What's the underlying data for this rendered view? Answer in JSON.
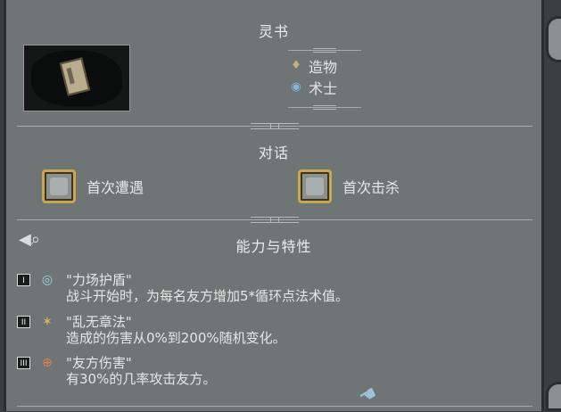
{
  "unit": {
    "name": "灵书",
    "types": [
      {
        "icon": "potion-icon",
        "label": "造物",
        "color": "#c8b27a"
      },
      {
        "icon": "eye-icon",
        "label": "术士",
        "color": "#7fb7e0"
      }
    ]
  },
  "dialogue": {
    "title": "对话",
    "items": [
      {
        "label": "首次遭遇"
      },
      {
        "label": "首次击杀"
      }
    ]
  },
  "abilities": {
    "title": "能力与特性",
    "items": [
      {
        "num": "I",
        "icon": "shield-orb-icon",
        "name": "\"力场护盾\"",
        "desc": "战斗开始时，为每名友方增加5*循环点法术值。"
      },
      {
        "num": "II",
        "icon": "chaos-icon",
        "name": "\"乱无章法\"",
        "desc": "造成的伤害从0%到200%随机变化。"
      },
      {
        "num": "III",
        "icon": "friendly-fire-icon",
        "name": "\"友方伤害\"",
        "desc": "有30%的几率攻击友方。"
      }
    ]
  },
  "colors": {
    "panel": "#6f7574",
    "frame": "#2a2e2e",
    "gold": "#c9a64f"
  }
}
